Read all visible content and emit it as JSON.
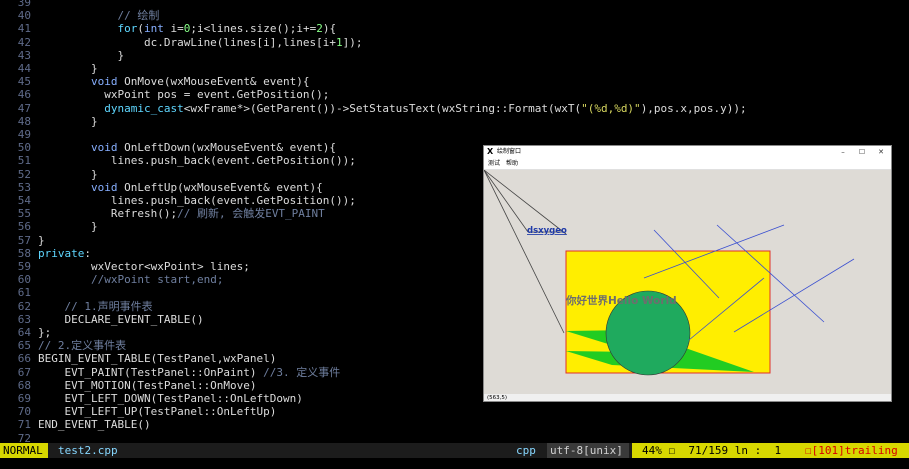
{
  "editor": {
    "lines": [
      {
        "n": "39",
        "parts": []
      },
      {
        "n": "40",
        "parts": [
          {
            "t": "            "
          },
          {
            "t": "// 绘制",
            "c": "cm"
          }
        ]
      },
      {
        "n": "41",
        "parts": [
          {
            "t": "            "
          },
          {
            "t": "for",
            "c": "kw"
          },
          {
            "t": "("
          },
          {
            "t": "int",
            "c": "ty"
          },
          {
            "t": " i="
          },
          {
            "t": "0",
            "c": "num"
          },
          {
            "t": ";i<lines.size();i+="
          },
          {
            "t": "2",
            "c": "num"
          },
          {
            "t": "){"
          }
        ]
      },
      {
        "n": "42",
        "parts": [
          {
            "t": "                dc.DrawLine(lines[i],lines[i+"
          },
          {
            "t": "1",
            "c": "num"
          },
          {
            "t": "]);"
          }
        ]
      },
      {
        "n": "43",
        "parts": [
          {
            "t": "            }"
          }
        ]
      },
      {
        "n": "44",
        "parts": [
          {
            "t": "        }"
          }
        ]
      },
      {
        "n": "45",
        "parts": [
          {
            "t": "        "
          },
          {
            "t": "void",
            "c": "ty"
          },
          {
            "t": " OnMove(wxMouseEvent& event){"
          }
        ]
      },
      {
        "n": "46",
        "parts": [
          {
            "t": "          wxPoint pos = event.GetPosition();"
          }
        ]
      },
      {
        "n": "47",
        "parts": [
          {
            "t": "          "
          },
          {
            "t": "dynamic_cast",
            "c": "kw"
          },
          {
            "t": "<wxFrame*>(GetParent())->SetStatusText(wxString::Format(wxT("
          },
          {
            "t": "\"(%d,%d)\"",
            "c": "str"
          },
          {
            "t": "),pos.x,pos.y));"
          }
        ]
      },
      {
        "n": "48",
        "parts": [
          {
            "t": "        }"
          }
        ]
      },
      {
        "n": "49",
        "parts": []
      },
      {
        "n": "50",
        "parts": [
          {
            "t": "        "
          },
          {
            "t": "void",
            "c": "ty"
          },
          {
            "t": " OnLeftDown(wxMouseEvent& event){"
          }
        ]
      },
      {
        "n": "51",
        "parts": [
          {
            "t": "           lines.push_back(event.GetPosition());"
          }
        ]
      },
      {
        "n": "52",
        "parts": [
          {
            "t": "        }"
          }
        ]
      },
      {
        "n": "53",
        "parts": [
          {
            "t": "        "
          },
          {
            "t": "void",
            "c": "ty"
          },
          {
            "t": " OnLeftUp(wxMouseEvent& event){"
          }
        ]
      },
      {
        "n": "54",
        "parts": [
          {
            "t": "           lines.push_back(event.GetPosition());"
          }
        ]
      },
      {
        "n": "55",
        "parts": [
          {
            "t": "           Refresh();"
          },
          {
            "t": "// 刷新, 会触发EVT_PAINT",
            "c": "cm"
          }
        ]
      },
      {
        "n": "56",
        "parts": [
          {
            "t": "        }"
          }
        ]
      },
      {
        "n": "57",
        "parts": [
          {
            "t": "}"
          }
        ]
      },
      {
        "n": "58",
        "parts": [
          {
            "t": "private",
            "c": "kw"
          },
          {
            "t": ":"
          }
        ]
      },
      {
        "n": "59",
        "parts": [
          {
            "t": "        wxVector<wxPoint> lines;"
          }
        ]
      },
      {
        "n": "60",
        "parts": [
          {
            "t": "        "
          },
          {
            "t": "//wxPoint start,end;",
            "c": "cm"
          }
        ]
      },
      {
        "n": "61",
        "parts": []
      },
      {
        "n": "62",
        "parts": [
          {
            "t": "    "
          },
          {
            "t": "// 1.声明事件表",
            "c": "cm"
          }
        ]
      },
      {
        "n": "63",
        "parts": [
          {
            "t": "    DECLARE_EVENT_TABLE()"
          }
        ]
      },
      {
        "n": "64",
        "parts": [
          {
            "t": "};"
          }
        ]
      },
      {
        "n": "65",
        "parts": [
          {
            "t": "// 2.定义事件表",
            "c": "cm"
          }
        ]
      },
      {
        "n": "66",
        "parts": [
          {
            "t": "BEGIN_EVENT_TABLE(TestPanel,wxPanel)"
          }
        ]
      },
      {
        "n": "67",
        "parts": [
          {
            "t": "    EVT_PAINT(TestPanel::OnPaint) "
          },
          {
            "t": "//3. 定义事件",
            "c": "cm"
          }
        ]
      },
      {
        "n": "68",
        "parts": [
          {
            "t": "    EVT_MOTION(TestPanel::OnMove)"
          }
        ]
      },
      {
        "n": "69",
        "parts": [
          {
            "t": "    EVT_LEFT_DOWN(TestPanel::OnLeftDown)"
          }
        ]
      },
      {
        "n": "70",
        "parts": [
          {
            "t": "    EVT_LEFT_UP(TestPanel::OnLeftUp)"
          }
        ]
      },
      {
        "n": "71",
        "parts": [
          {
            "t": "END_EVENT_TABLE()"
          }
        ]
      },
      {
        "n": "72",
        "parts": []
      }
    ]
  },
  "statusline": {
    "mode": "NORMAL",
    "filename": "test2.cpp",
    "filetype": "cpp",
    "encoding": "utf-8[unix]",
    "percent": "44% ☐  71/159 ln :  1",
    "trailing": "☐[101]trailing"
  },
  "app_window": {
    "title": "绘制窗口",
    "title_icon": "X",
    "controls": {
      "minimize": "–",
      "maximize": "☐",
      "close": "✕"
    },
    "menus": [
      "测试",
      "帮助"
    ],
    "canvas": {
      "link_text": "dsxygeo",
      "hello_text": "你好世界Hello World",
      "colors": {
        "background": "#dedbd6",
        "rect_fill": "#ffee00",
        "rect_border": "#e0302a",
        "circle_fill": "#1faa5e",
        "polygon_fill": "#22cc22",
        "line_blue": "#3a4fd0",
        "line_dark": "#444444"
      }
    },
    "status_text": "(563,5)"
  }
}
